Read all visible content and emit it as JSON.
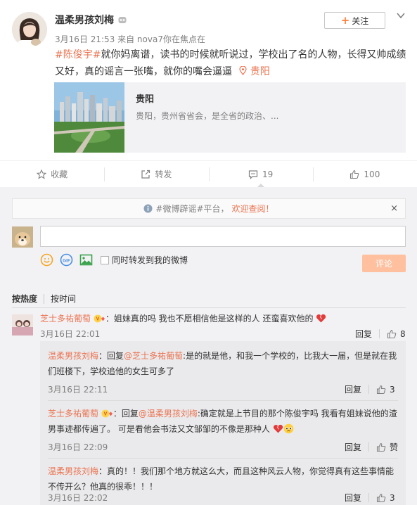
{
  "post": {
    "author": "温柔男孩刘梅",
    "follow_label": "关注",
    "meta": "3月16日 21:53 来自 nova7你在焦点在",
    "hashtag": "#陈俊宇#",
    "text": "就你妈离谱，读书的时候就听说过，学校出了名的人物，长得又帅成绩又好，真的谣言一张嘴，就你的嘴会逼逼",
    "location": "贵阳",
    "card": {
      "title": "贵阳",
      "desc": "贵阳，贵州省省会，是全省的政治、..."
    }
  },
  "actions": [
    {
      "icon": "star-icon",
      "label": "收藏"
    },
    {
      "icon": "share-icon",
      "label": "转发"
    },
    {
      "icon": "comment-icon",
      "label": "19"
    },
    {
      "icon": "thumb-up-icon",
      "label": "100"
    }
  ],
  "notice": {
    "prefix": "#微博辟谣#平台，",
    "link": "欢迎查阅！",
    "close": "×"
  },
  "compose": {
    "repost_label": "同时转发到我的微博",
    "submit_label": "评论"
  },
  "sort": {
    "hot": "按热度",
    "time": "按时间"
  },
  "comments": [
    {
      "user": "芝士多祐葡萄",
      "text": "：姐妹真的吗 我也不愿相信他是这样的人 还蛮喜欢他的",
      "time": "3月16日 22:01",
      "reply_label": "回复",
      "likes": "8",
      "replies": [
        {
          "user": "温柔男孩刘梅",
          "pre": "：回复",
          "at": "@芝士多祐葡萄",
          "text": ":是的就是他，和我一个学校的，比我大一届，但是就在我们班楼下，学校追他的女生可多了",
          "time": "3月16日 22:11",
          "reply_label": "回复",
          "likes": "3"
        },
        {
          "user": "芝士多祐葡萄",
          "pre": "：回复",
          "at": "@温柔男孩刘梅",
          "text": ":确定就是上节目的那个陈俊宇吗 我看有姐妹说他的渣男事迹都传遍了。 可是看他会书法又文邹邹的不像是那种人",
          "time": "3月16日 22:09",
          "reply_label": "回复",
          "likes": "赞"
        },
        {
          "user": "温柔男孩刘梅",
          "pre": "",
          "at": "",
          "text": "：真的！！我们那个地方就这么大，而且这种风云人物，你觉得真有这些事情能不传开么？他真的很乖！！！",
          "time": "3月16日 22:02",
          "reply_label": "回复",
          "likes": "3"
        }
      ]
    }
  ],
  "colors": {
    "accent": "#eb7350",
    "submit_disabled": "#ffc09f",
    "section_bg": "#f2f2f5"
  }
}
